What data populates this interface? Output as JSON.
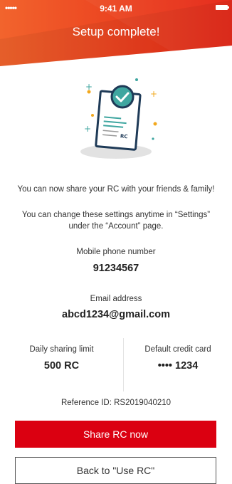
{
  "status_bar": {
    "signal": "•••••",
    "time": "9:41 AM"
  },
  "header": {
    "title": "Setup complete!"
  },
  "illustration": {
    "badge_text": "RC"
  },
  "messages": {
    "share": "You can now share your RC with your friends & family!",
    "settings_line1": "You can change these settings anytime in “Settings”",
    "settings_line2": "under the “Account” page."
  },
  "details": {
    "mobile_label": "Mobile phone number",
    "mobile_value": "91234567",
    "email_label": "Email address",
    "email_value": "abcd1234@gmail.com",
    "limit_label": "Daily sharing limit",
    "limit_value": "500 RC",
    "card_label": "Default credit card",
    "card_value": "•••• 1234",
    "reference": "Reference ID: RS2019040210"
  },
  "buttons": {
    "share": "Share RC now",
    "back": "Back to \"Use RC\""
  },
  "colors": {
    "brand_red": "#db0011",
    "header_orange": "#f05a28",
    "accent_teal": "#3fa6a0"
  }
}
